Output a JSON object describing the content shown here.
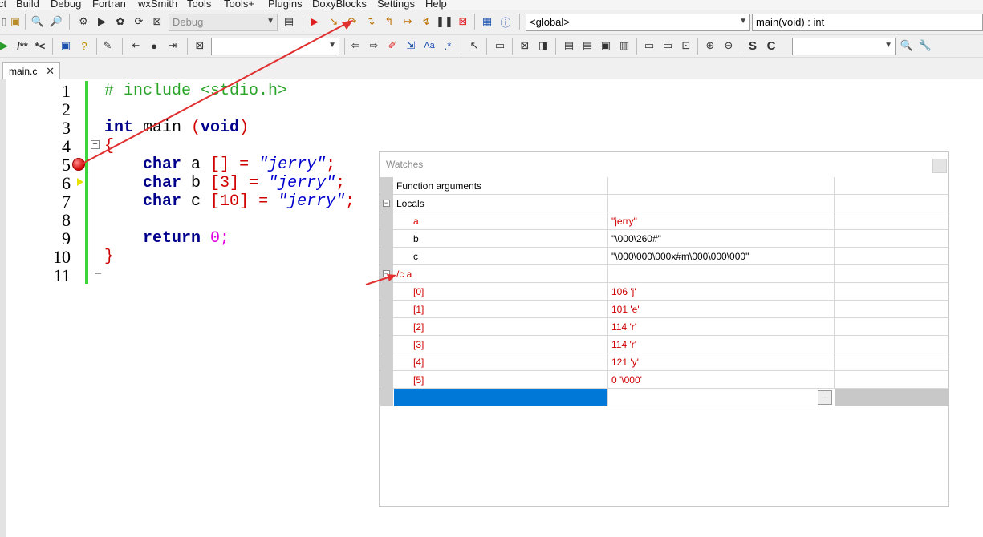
{
  "menu": [
    "ct",
    "Build",
    "Debug",
    "Fortran",
    "wxSmith",
    "Tools",
    "Tools+",
    "Plugins",
    "DoxyBlocks",
    "Settings",
    "Help"
  ],
  "toolbar": {
    "build_target": "Debug",
    "scope_combo": "<global>",
    "function_combo": "main(void) : int",
    "comment_label": "/**",
    "uncomment_label": "*<",
    "search_combo": "",
    "find_combo": ""
  },
  "tabs": [
    {
      "label": "main.c"
    }
  ],
  "editor": {
    "line_numbers": [
      "1",
      "2",
      "3",
      "4",
      "5",
      "6",
      "7",
      "8",
      "9",
      "10",
      "11"
    ],
    "lines": [
      "# include <stdio.h>",
      "",
      "int main (void)",
      "{",
      "    char a [] = \"jerry\";",
      "    char b [3] = \"jerry\";",
      "    char c [10] = \"jerry\";",
      "",
      "    return 0;",
      "}",
      ""
    ],
    "tokens": {
      "include": "# include <stdio.h>",
      "int": "int",
      "main": " main ",
      "void": "void",
      "char": "char",
      "var_a": " a ",
      "var_b": " b ",
      "var_c": " c ",
      "arr_empty": "[]",
      "arr_3": "[3]",
      "arr_10": "[10]",
      "eq": " = ",
      "str": "\"jerry\"",
      "semi": ";",
      "return": "return",
      "zero": " 0;",
      "lbrace": "{",
      "rbrace": "}",
      "lparen": "(",
      "rparen": ")"
    },
    "breakpoint_line": 5,
    "current_line": 6
  },
  "watches": {
    "title": "Watches",
    "rows": [
      {
        "name": "Function arguments",
        "value": "",
        "indent": 0,
        "red": false,
        "expander": false
      },
      {
        "name": "Locals",
        "value": "",
        "indent": 0,
        "red": false,
        "expander": true
      },
      {
        "name": "a",
        "value": "\"jerry\"",
        "indent": 2,
        "red": true,
        "expander": false
      },
      {
        "name": "b",
        "value": "\"\\000\\260#\"",
        "indent": 2,
        "red": false,
        "expander": false
      },
      {
        "name": "c",
        "value": "\"\\000\\000\\000x#m\\000\\000\\000\"",
        "indent": 2,
        "red": false,
        "expander": false
      },
      {
        "name": "/c a",
        "value": "",
        "indent": 0,
        "red": true,
        "expander": true
      },
      {
        "name": "[0]",
        "value": "106 'j'",
        "indent": 2,
        "red": true,
        "expander": false
      },
      {
        "name": "[1]",
        "value": "101 'e'",
        "indent": 2,
        "red": true,
        "expander": false
      },
      {
        "name": "[2]",
        "value": "114 'r'",
        "indent": 2,
        "red": true,
        "expander": false
      },
      {
        "name": "[3]",
        "value": "114 'r'",
        "indent": 2,
        "red": true,
        "expander": false
      },
      {
        "name": "[4]",
        "value": "121 'y'",
        "indent": 2,
        "red": true,
        "expander": false
      },
      {
        "name": "[5]",
        "value": "0 '\\000'",
        "indent": 2,
        "red": true,
        "expander": false
      }
    ],
    "edit_button_label": "..."
  },
  "colors": {
    "keyword": "#00008b",
    "preprocessor": "#2aa52a",
    "punctuation": "#d00000",
    "string": "#0000cd",
    "number": "#e000e0",
    "selection": "#0078d7",
    "changebar": "#3cd63c",
    "annotation_arrow": "#e03030"
  },
  "icons": [
    "open-icon",
    "paste-icon",
    "find-icon",
    "replace-icon",
    "settings-icon",
    "run-icon",
    "build-run-icon",
    "rebuild-icon",
    "stop-build-icon",
    "debug-icon",
    "run-to-cursor-icon",
    "next-line-icon",
    "step-into-icon",
    "step-out-icon",
    "next-instruction-icon",
    "break-icon",
    "stop-debug-icon",
    "debug-windows-icon",
    "info-icon"
  ]
}
